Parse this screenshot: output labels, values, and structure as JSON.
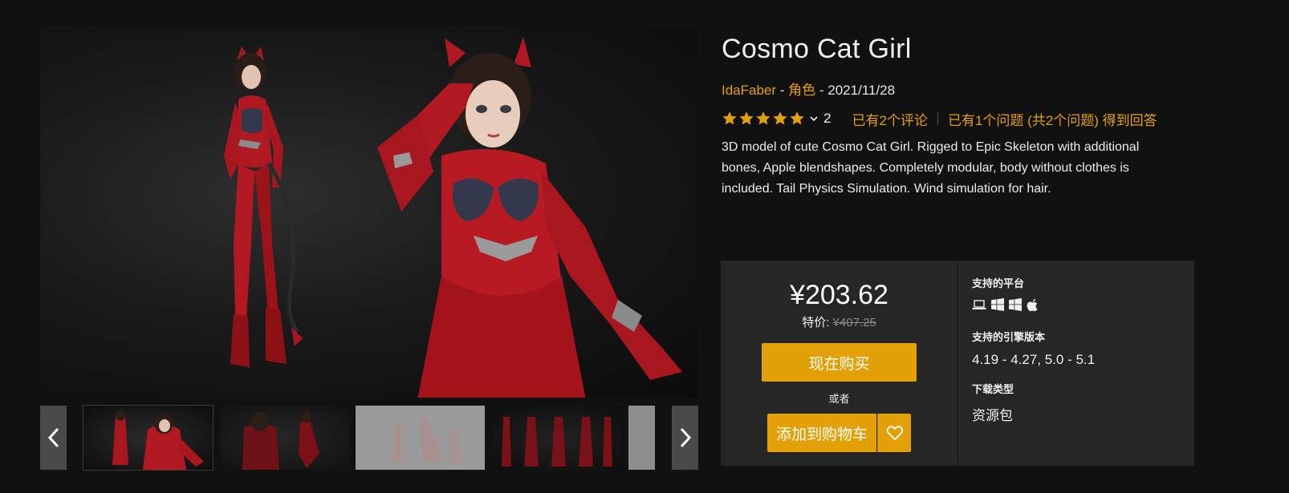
{
  "product": {
    "title": "Cosmo Cat Girl",
    "author": "IdaFaber",
    "meta_separator": " - ",
    "category": "角色",
    "date": "2021/11/28",
    "rating_stars": 5,
    "rating_count": "2",
    "reviews_link": "已有2个评论",
    "questions_link": "已有1个问题 (共2个问题) 得到回答",
    "description": "3D model of cute Cosmo Cat Girl. Rigged to Epic Skeleton with additional bones, Apple blendshapes. Completely modular, body without clothes is included. Tail Physics Simulation. Wind simulation for hair."
  },
  "purchase": {
    "price": "¥203.62",
    "sale_label": "特价: ",
    "original_price": "¥407.25",
    "buy_now": "现在购买",
    "or": "或者",
    "add_to_cart": "添加到购物车"
  },
  "specs": {
    "platforms_label": "支持的平台",
    "platforms": [
      "laptop-icon",
      "windows-icon",
      "windows-icon",
      "apple-icon"
    ],
    "engine_label": "支持的引擎版本",
    "engine_value": "4.19 - 4.27, 5.0 - 5.1",
    "download_label": "下载类型",
    "download_value": "资源包"
  },
  "gallery": {
    "thumbnail_count": 5
  },
  "colors": {
    "accent": "#e3a008",
    "background": "#111111",
    "panel": "#262626"
  }
}
